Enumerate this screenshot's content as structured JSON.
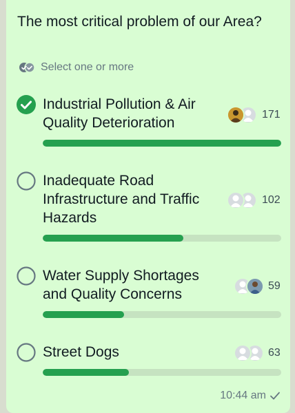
{
  "poll": {
    "question": "The most critical problem of our Area?",
    "hint": "Select one or more",
    "options": [
      {
        "label_line1": "Industrial Pollution & Air",
        "label_line2": "Quality Deterioration",
        "count": "171",
        "fraction": 1.0,
        "selected": true
      },
      {
        "label_line1": "Inadequate Road",
        "label_line2": "Infrastructure and Traffic",
        "label_line3": "Hazards",
        "count": "102",
        "fraction": 0.59,
        "selected": false
      },
      {
        "label_line1": "Water Supply Shortages",
        "label_line2": "and Quality Concerns",
        "count": "59",
        "fraction": 0.34,
        "selected": false
      },
      {
        "label_line1": "Street Dogs",
        "count": "63",
        "fraction": 0.36,
        "selected": false
      }
    ]
  },
  "message": {
    "time": "10:44 am"
  },
  "colors": {
    "accent": "#25a04f",
    "bubble": "#d9fdd3",
    "track": "#c6e3c1"
  }
}
